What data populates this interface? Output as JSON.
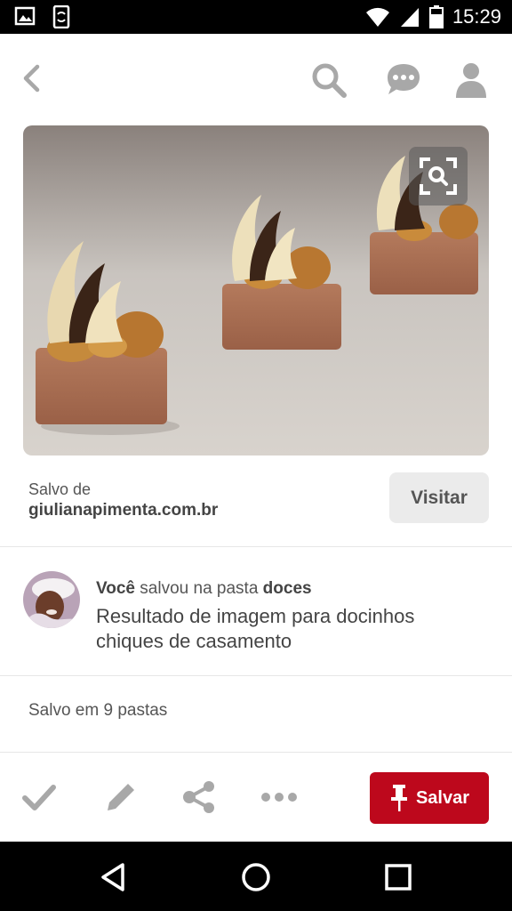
{
  "status_bar": {
    "time": "15:29",
    "left_icons": [
      "image-icon",
      "phone-sync-icon"
    ],
    "right_icons": [
      "wifi-icon",
      "signal-icon",
      "battery-icon"
    ]
  },
  "toolbar": {
    "icons": [
      "back-icon",
      "search-icon",
      "chat-icon",
      "profile-icon"
    ]
  },
  "pin": {
    "image_subject": "chocolate-dessert-cups",
    "lens_icon": "visual-search-icon"
  },
  "source": {
    "saved_from_label": "Salvo de",
    "domain": "giulianapimenta.com.br",
    "visit_label": "Visitar"
  },
  "activity": {
    "user": "Você",
    "action_text": "salvou na pasta",
    "board": "doces",
    "description": "Resultado de imagem para docinhos chiques de casamento"
  },
  "saved_count_text": "Salvo em 9 pastas",
  "actions": {
    "icons": [
      "check-icon",
      "pencil-icon",
      "share-icon",
      "more-icon"
    ],
    "save_label": "Salvar"
  },
  "nav_bar": {
    "icons": [
      "nav-back-icon",
      "nav-home-icon",
      "nav-recents-icon"
    ]
  },
  "colors": {
    "save_button": "#bd081c",
    "visit_button": "#ebebeb",
    "icon_gray": "#a8a8a8"
  }
}
